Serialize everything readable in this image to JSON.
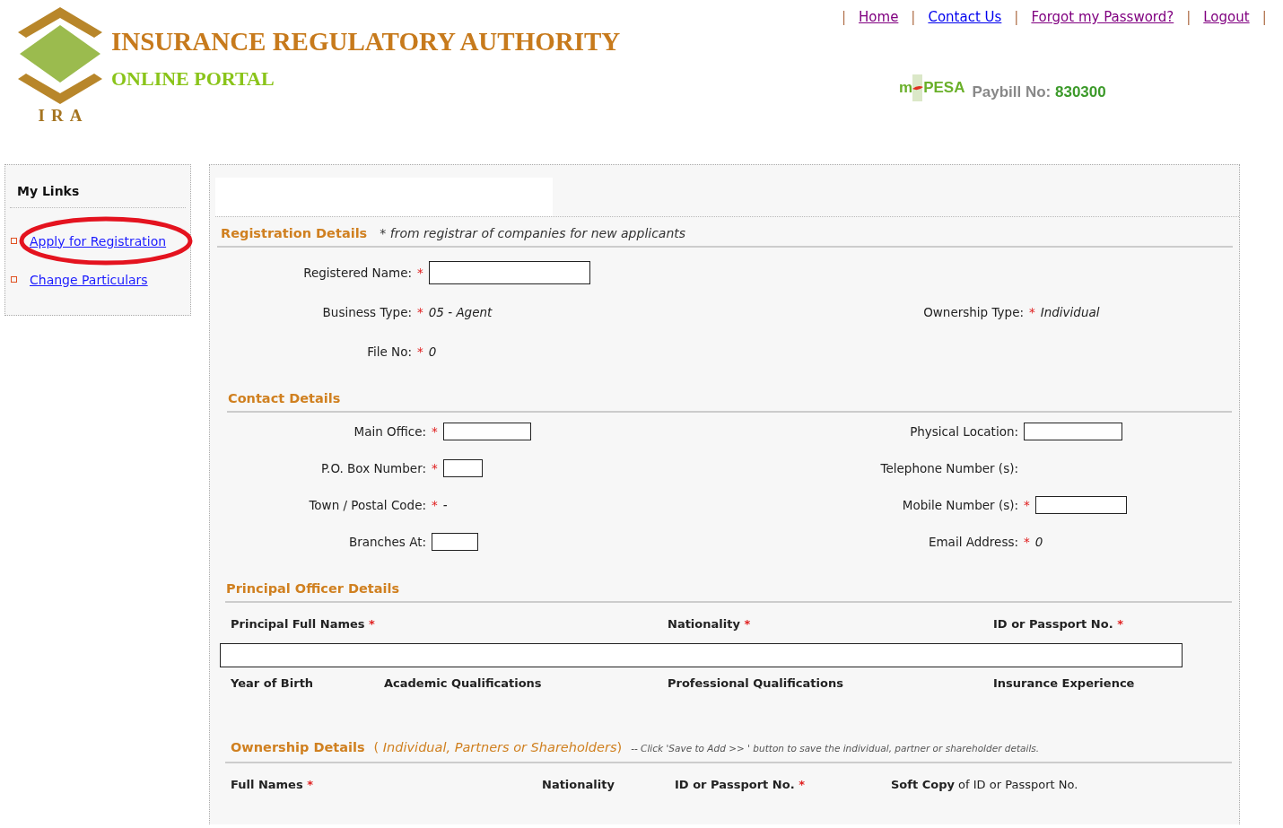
{
  "logo": {
    "caption": "IRA",
    "title": "INSURANCE REGULATORY AUTHORITY",
    "subtitle": "ONLINE PORTAL"
  },
  "separator": "|",
  "nav": [
    {
      "label": "Home",
      "visited": true
    },
    {
      "label": "Contact Us",
      "visited": false
    },
    {
      "label": "Forgot my Password?",
      "visited": true
    },
    {
      "label": "Logout",
      "visited": true
    }
  ],
  "mpesa": {
    "left": "m",
    "right": "PESA",
    "paybill_label": "Paybill No:",
    "paybill_number": "830300"
  },
  "sidebar": {
    "title": "My Links",
    "items": [
      {
        "label": "Apply for Registration",
        "circled": true
      },
      {
        "label": "Change Particulars",
        "circled": false
      }
    ]
  },
  "required_mark": "*",
  "registration": {
    "title": "Registration Details",
    "note": "* *from registrar of companies for new applicants*",
    "rows": [
      [
        {
          "label": "Registered Name:",
          "required": true,
          "kind": "input"
        },
        null
      ],
      [
        {
          "label": "Business Type:",
          "required": true,
          "kind": "text",
          "value": "05 - Agent"
        },
        {
          "label": "Ownership Type:",
          "required": true,
          "kind": "text",
          "value": "Individual"
        }
      ],
      [
        {
          "label": "File No:",
          "required": true,
          "kind": "text",
          "value": "0"
        },
        null
      ]
    ]
  },
  "contact": {
    "title": "Contact Details",
    "rows": [
      [
        {
          "label": "Main Office:",
          "required": true,
          "kind": "input"
        },
        {
          "label": "Physical Location:",
          "required": false,
          "kind": "input"
        }
      ],
      [
        {
          "label": "P.O. Box Number:",
          "required": true,
          "kind": "input"
        },
        {
          "label": "Telephone Number (s):",
          "required": false,
          "kind": "none"
        }
      ],
      [
        {
          "label": "Town / Postal Code:",
          "required": true,
          "kind": "text",
          "value": "-"
        },
        {
          "label": "Mobile Number (s):",
          "required": true,
          "kind": "input"
        }
      ],
      [
        {
          "label": "Branches At:",
          "required": false,
          "kind": "input"
        },
        {
          "label": "Email Address:",
          "required": true,
          "kind": "text",
          "value": "0"
        }
      ]
    ]
  },
  "principal": {
    "title": "Principal Officer Details",
    "columns": [
      {
        "label": "Principal Full Names",
        "required": true
      },
      {
        "label": "Nationality",
        "required": true
      },
      {
        "label": "ID or Passport No.",
        "required": true
      }
    ],
    "columns_2": [
      {
        "label": "Year of Birth"
      },
      {
        "label": "Academic Qualifications"
      },
      {
        "label": "Professional Qualifications"
      },
      {
        "label": "Insurance Experience"
      }
    ]
  },
  "ownership": {
    "title": "Ownership Details",
    "scope": "( *Individual, Partners or Shareholders*)",
    "note": "-- Click 'Save to Add >> ' button to save the individual, partner or shareholder details.",
    "columns": [
      {
        "label": "Full Names",
        "required": true
      },
      {
        "label": "Nationality",
        "required": false
      },
      {
        "label": "ID or Passport No.",
        "required": true
      },
      {
        "label": "**Soft Copy** of ID or Passport No.",
        "required": false
      }
    ]
  }
}
